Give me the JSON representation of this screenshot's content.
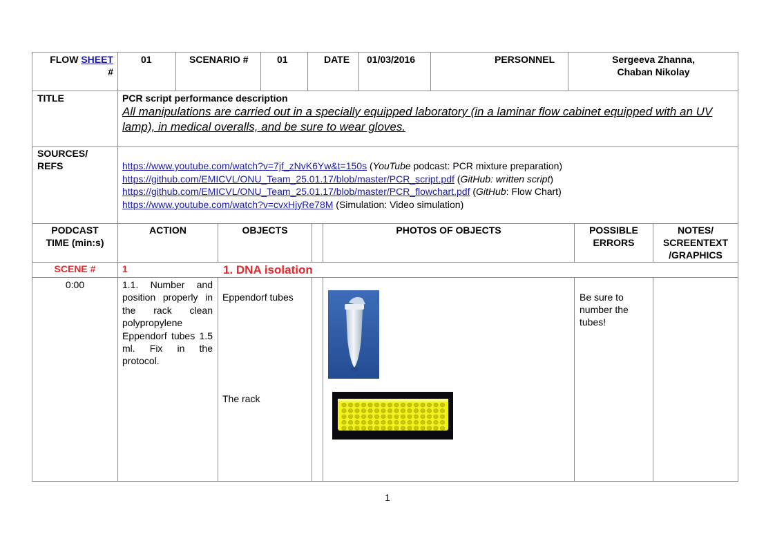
{
  "header": {
    "flow_sheet_prefix": "FLOW",
    "flow_sheet_link": "SHEET",
    "flow_sheet_hash": "#",
    "flow_sheet_value": "01",
    "scenario_label": "SCENARIO #",
    "scenario_value": "01",
    "date_label": "DATE",
    "date_value": "01/03/2016",
    "personnel_label": "PERSONNEL",
    "personnel_value_1": "Sergeeva Zhanna,",
    "personnel_value_2": "Chaban Nikolay"
  },
  "title_row": {
    "label": "TITLE",
    "heading": "PCR script performance description",
    "description": "All manipulations are carried out in a specially equipped laboratory (in a laminar flow cabinet equipped with an UV lamp), in medical overalls, and be sure to wear gloves."
  },
  "sources": {
    "label_1": "SOURCES/",
    "label_2": "REFS",
    "refs": [
      {
        "url": "https://www.youtube.com/watch?v=7jf_zNvK6Yw&t=150s",
        "pre": " (",
        "em": "YouTube",
        "post": " podcast: PCR mixture preparation)"
      },
      {
        "url": "https://github.com/EMICVL/ONU_Team_25.01.17/blob/master/PCR_script.pdf",
        "pre": " (",
        "em": "GitHub: written script",
        "post": ")"
      },
      {
        "url": "https://github.com/EMICVL/ONU_Team_25.01.17/blob/master/PCR_flowchart.pdf",
        "pre": " (",
        "em": "GitHub",
        "post": ": Flow Chart)"
      },
      {
        "url": "https://www.youtube.com/watch?v=cvxHjyRe78M",
        "pre": " (Simulation: Video simulation)",
        "em": "",
        "post": ""
      }
    ]
  },
  "columns": {
    "podcast_time_1": "PODCAST",
    "podcast_time_2": "TIME (min:s)",
    "action": "ACTION",
    "objects": "OBJECTS",
    "photos": "PHOTOS OF OBJECTS",
    "errors_1": "POSSIBLE",
    "errors_2": "ERRORS",
    "notes_1": "NOTES/",
    "notes_2": "SCREENTEXT",
    "notes_3": "/GRAPHICS"
  },
  "scene": {
    "label": "SCENE #",
    "number": "1",
    "title": "1. DNA isolation"
  },
  "row1": {
    "time": "0:00",
    "action": "1.1. Number and position properly in the rack clean polypropylene Eppendorf tubes 1.5 ml. Fix in the protocol.",
    "object_1": "Eppendorf tubes",
    "object_2": "The rack",
    "error": "Be sure to number the tubes!",
    "photo_1_colors": {
      "bg": "#2f5ba8",
      "tube": "#e6ecf2"
    },
    "photo_2_colors": {
      "bg": "#0a0a10",
      "rack": "#f2f21a"
    }
  },
  "footer": {
    "page_number": "1"
  }
}
